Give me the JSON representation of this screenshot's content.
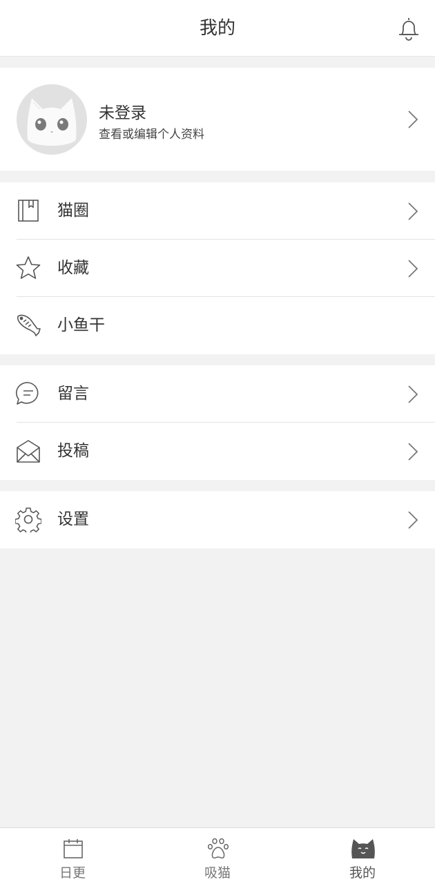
{
  "header": {
    "title": "我的",
    "bell_icon": "bell-icon"
  },
  "profile": {
    "avatar_icon": "cat-avatar-icon",
    "name": "未登录",
    "subtitle": "查看或编辑个人资料"
  },
  "menu": {
    "group1": [
      {
        "label": "猫圈",
        "icon": "notebook-icon",
        "has_arrow": true
      },
      {
        "label": "收藏",
        "icon": "star-icon",
        "has_arrow": true
      },
      {
        "label": "小鱼干",
        "icon": "fish-icon",
        "has_arrow": false
      }
    ],
    "group2": [
      {
        "label": "留言",
        "icon": "chat-bubble-icon",
        "has_arrow": true
      },
      {
        "label": "投稿",
        "icon": "envelope-icon",
        "has_arrow": true
      }
    ],
    "group3": [
      {
        "label": "设置",
        "icon": "gear-icon",
        "has_arrow": true
      }
    ]
  },
  "tabbar": [
    {
      "label": "日更",
      "icon": "calendar-icon",
      "active": false
    },
    {
      "label": "吸猫",
      "icon": "paw-icon",
      "active": false
    },
    {
      "label": "我的",
      "icon": "cat-face-icon",
      "active": true
    }
  ],
  "colors": {
    "background": "#f2f2f2",
    "card": "#ffffff",
    "text": "#333333",
    "icon_stroke": "#555555"
  }
}
